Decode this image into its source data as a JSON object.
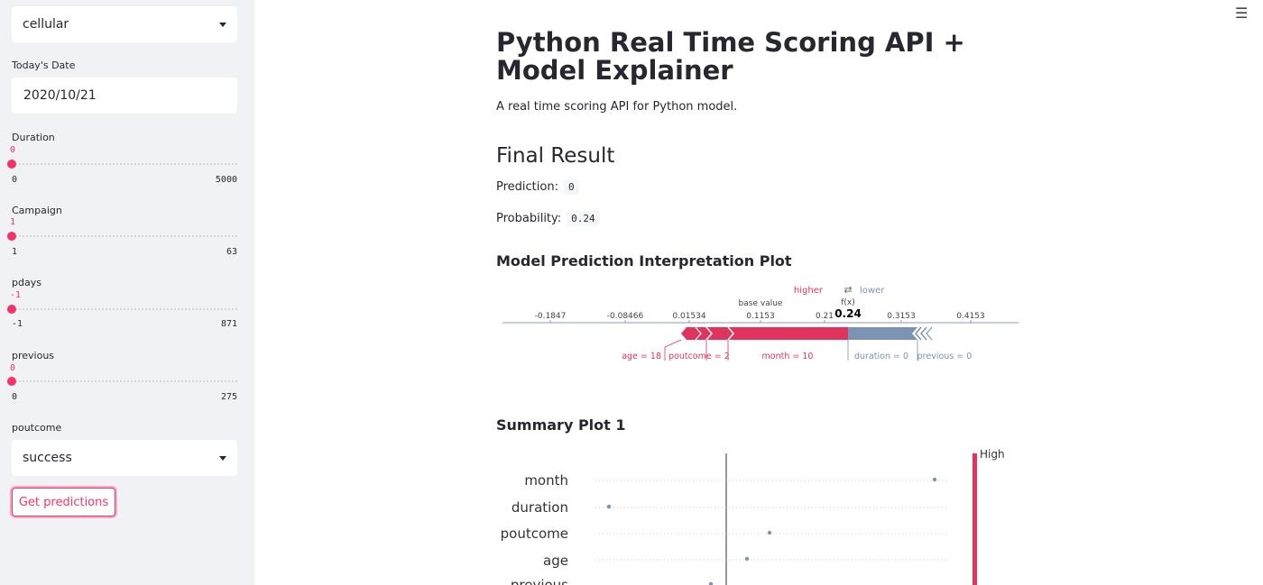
{
  "sidebar": {
    "contact_select": {
      "value": "cellular"
    },
    "date": {
      "label": "Today's Date",
      "value": "2020/10/21"
    },
    "sliders": [
      {
        "label": "Duration",
        "value": "0",
        "min": "0",
        "max": "5000",
        "fraction": 0
      },
      {
        "label": "Campaign",
        "value": "1",
        "min": "1",
        "max": "63",
        "fraction": 0
      },
      {
        "label": "pdays",
        "value": "-1",
        "min": "-1",
        "max": "871",
        "fraction": 0
      },
      {
        "label": "previous",
        "value": "0",
        "min": "0",
        "max": "275",
        "fraction": 0
      }
    ],
    "poutcome": {
      "label": "poutcome",
      "value": "success"
    },
    "predict_button": "Get predictions"
  },
  "menu_icon": "hamburger-icon",
  "main": {
    "title": "Python Real Time Scoring API + Model Explainer",
    "subtitle": "A real time scoring API for Python model.",
    "result_header": "Final Result",
    "prediction_label": "Prediction:",
    "prediction_value": "0",
    "probability_label": "Probability:",
    "probability_value": "0.24",
    "force_plot_header": "Model Prediction Interpretation Plot",
    "summary_plot_header": "Summary Plot 1"
  },
  "force_plot": {
    "higher": "higher",
    "arrows": "⇄",
    "lower": "lower",
    "base_value_label": "base value",
    "fx_label": "f(x)",
    "fx_value": "0.24",
    "ticks": [
      "-0.1847",
      "-0.08466",
      "0.01534",
      "0.1153",
      "0.21",
      "0.3153",
      "0.4153"
    ],
    "positive_features": [
      "age = 18",
      "poutcome = 2",
      "month = 10"
    ],
    "negative_features": [
      "duration = 0",
      "previous = 0"
    ],
    "colors": {
      "positive": "#e0345f",
      "negative": "#7b94b4"
    }
  },
  "chart_data": {
    "type": "scatter",
    "title": "Summary Plot 1",
    "features": [
      "month",
      "duration",
      "poutcome",
      "age",
      "previous"
    ],
    "colorbar_label": "High",
    "colors": {
      "high": "#e0345f",
      "low": "#7b94b4"
    }
  }
}
